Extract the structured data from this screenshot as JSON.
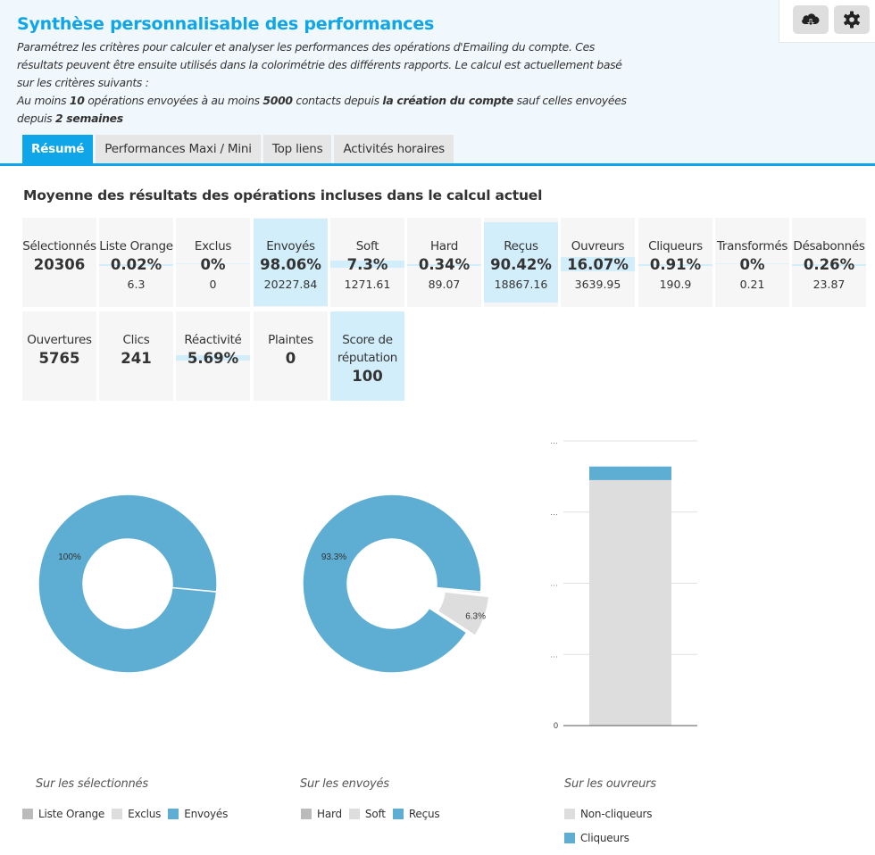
{
  "header": {
    "title": "Synthèse personnalisable des performances",
    "desc_line1": "Paramétrez les critères pour calculer et analyser les performances des opérations d'Emailing du compte. Ces résultats peuvent être ensuite utilisés dans la colorimétrie des différents rapports. Le calcul est actuellement basé sur les critères suivants :",
    "criteria": {
      "t1": "Au moins ",
      "min_ops": "10",
      "t2": " opérations envoyées à au moins ",
      "min_contacts": "5000",
      "t3": " contacts depuis ",
      "since": "la création du compte",
      "t4": " sauf celles envoyées depuis ",
      "excluded": "2 semaines"
    },
    "tools": [
      {
        "icon": "cloud-download-icon",
        "label": "Télécharger"
      },
      {
        "icon": "gear-icon",
        "label": "Paramètres"
      }
    ]
  },
  "tabs": [
    {
      "label": "Résumé",
      "active": true
    },
    {
      "label": "Performances Maxi / Mini",
      "active": false
    },
    {
      "label": "Top liens",
      "active": false
    },
    {
      "label": "Activités horaires",
      "active": false
    }
  ],
  "section_title": "Moyenne des résultats des opérations incluses dans le calcul actuel",
  "metrics_row1": [
    {
      "label": "Sélectionnés",
      "pct": "20306",
      "sub": "",
      "fill": 0
    },
    {
      "label": "Liste Orange",
      "pct": "0.02%",
      "sub": "6.3",
      "fill": 0.0002
    },
    {
      "label": "Exclus",
      "pct": "0%",
      "sub": "0",
      "fill": 0
    },
    {
      "label": "Envoyés",
      "pct": "98.06%",
      "sub": "20227.84",
      "fill": 0.9806
    },
    {
      "label": "Soft",
      "pct": "7.3%",
      "sub": "1271.61",
      "fill": 0.073
    },
    {
      "label": "Hard",
      "pct": "0.34%",
      "sub": "89.07",
      "fill": 0.0034
    },
    {
      "label": "Reçus",
      "pct": "90.42%",
      "sub": "18867.16",
      "fill": 0.9042
    },
    {
      "label": "Ouvreurs",
      "pct": "16.07%",
      "sub": "3639.95",
      "fill": 0.1607
    },
    {
      "label": "Cliqueurs",
      "pct": "0.91%",
      "sub": "190.9",
      "fill": 0.0091
    },
    {
      "label": "Transformés",
      "pct": "0%",
      "sub": "0.21",
      "fill": 0
    },
    {
      "label": "Désabonnés",
      "pct": "0.26%",
      "sub": "23.87",
      "fill": 0.0026
    }
  ],
  "metrics_row2": [
    {
      "label": "Ouvertures",
      "pct": "5765",
      "sub": "",
      "fill": 0
    },
    {
      "label": "Clics",
      "pct": "241",
      "sub": "",
      "fill": 0
    },
    {
      "label": "Réactivité",
      "pct": "5.69%",
      "sub": "",
      "fill": 0.0569
    },
    {
      "label": "Plaintes",
      "pct": "0",
      "sub": "",
      "fill": 0
    },
    {
      "label": "Score de réputation",
      "pct": "100",
      "sub": "",
      "fill": 1.0
    }
  ],
  "colors": {
    "accent": "#0ea5e9",
    "series_blue": "#5eadd3",
    "series_light": "#dddddd",
    "series_mid": "#bbbbbb",
    "fill_light_blue": "#d3eefb"
  },
  "chart_data": [
    {
      "type": "pie",
      "title": "Sur les sélectionnés",
      "donut": true,
      "slices": [
        {
          "name": "Liste Orange",
          "value": 0.02,
          "color": "#bbbbbb",
          "label": ""
        },
        {
          "name": "Exclus",
          "value": 0,
          "color": "#dddddd",
          "label": ""
        },
        {
          "name": "Envoyés",
          "value": 98.06,
          "color": "#5eadd3",
          "label": "100%"
        }
      ],
      "legend": [
        "Liste Orange",
        "Exclus",
        "Envoyés"
      ],
      "legend_position": "bottom"
    },
    {
      "type": "pie",
      "title": "Sur les envoyés",
      "donut": true,
      "slices": [
        {
          "name": "Hard",
          "value": 0.34,
          "color": "#bbbbbb",
          "label": ""
        },
        {
          "name": "Soft",
          "value": 7.3,
          "color": "#dddddd",
          "label": "6.3%",
          "exploded": true
        },
        {
          "name": "Reçus",
          "value": 90.42,
          "color": "#5eadd3",
          "label": "93.3%"
        }
      ],
      "legend": [
        "Hard",
        "Soft",
        "Reçus"
      ],
      "legend_position": "bottom"
    },
    {
      "type": "bar",
      "stacked": true,
      "title": "Sur les ouvreurs",
      "categories": [
        ""
      ],
      "series": [
        {
          "name": "Non-cliqueurs",
          "values": [
            3449.05
          ],
          "color": "#dddddd"
        },
        {
          "name": "Cliqueurs",
          "values": [
            190.9
          ],
          "color": "#5eadd3"
        }
      ],
      "ylim": [
        0,
        4000
      ],
      "yticks": [
        0,
        1000,
        2000,
        3000,
        4000
      ],
      "ytick_labels": [
        "0",
        "…",
        "…",
        "…",
        "…"
      ],
      "grid": true,
      "legend": [
        "Non-cliqueurs",
        "Cliqueurs"
      ],
      "legend_position": "bottom"
    }
  ]
}
